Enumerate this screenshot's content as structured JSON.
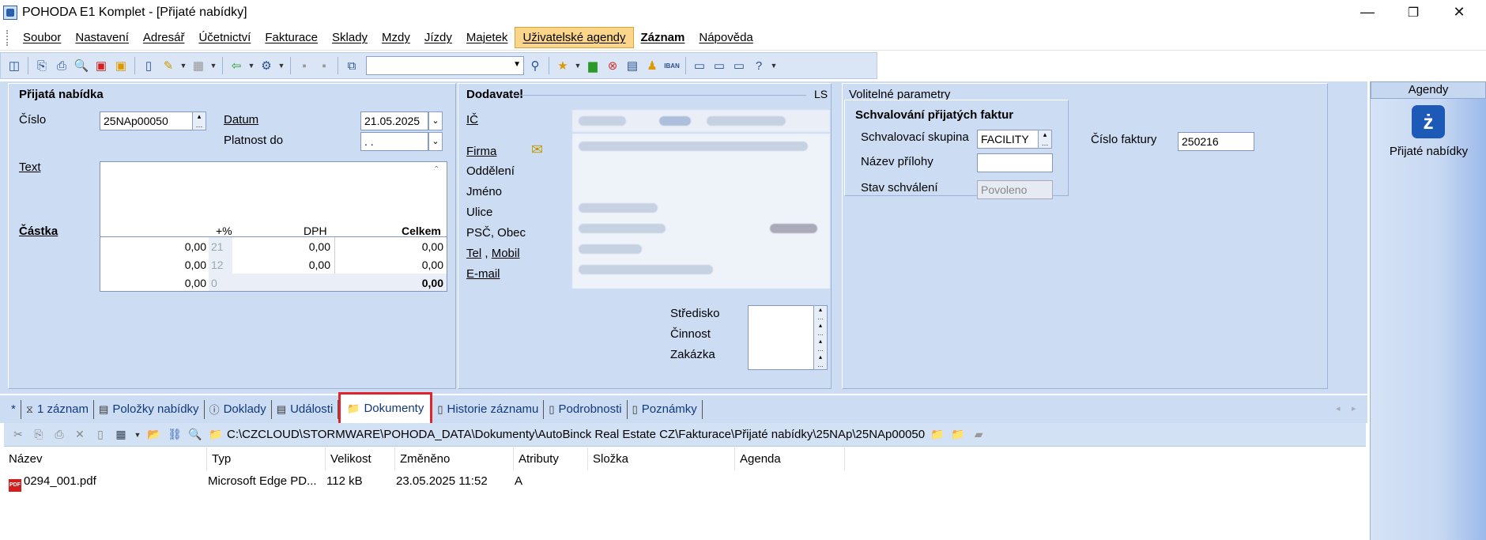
{
  "window": {
    "title": "POHODA E1 Komplet - [Přijaté nabídky]",
    "minimize": "—",
    "restore": "❐",
    "close": "✕"
  },
  "menu": [
    "Soubor",
    "Nastavení",
    "Adresář",
    "Účetnictví",
    "Fakturace",
    "Sklady",
    "Mzdy",
    "Jízdy",
    "Majetek",
    "Uživatelské agendy",
    "Záznam",
    "Nápověda"
  ],
  "toolbar": {
    "combo_value": ""
  },
  "prijata_nabidka": {
    "section": "Přijatá nabídka",
    "cislo_label": "Číslo",
    "cislo": "25NAp00050",
    "datum_label": "Datum",
    "datum": "21.05.2025",
    "platnost_label": "Platnost do",
    "platnost": " . .",
    "text_label": "Text",
    "castka_label": "Částka",
    "col_pct": "+%",
    "col_dph": "DPH",
    "col_celkem": "Celkem",
    "rows": [
      {
        "zaklad": "0,00",
        "pct": "21",
        "dph": "0,00",
        "celkem": "0,00"
      },
      {
        "zaklad": "0,00",
        "pct": "12",
        "dph": "0,00",
        "celkem": "0,00"
      },
      {
        "zaklad": "0,00",
        "pct": "0",
        "dph": "",
        "celkem": "0,00"
      }
    ]
  },
  "dodavatel": {
    "section": "Dodavatel",
    "ls": "LS",
    "ic": "IČ",
    "firma": "Firma",
    "oddeleni": "Oddělení",
    "jmeno": "Jméno",
    "ulice": "Ulice",
    "psc": "PSČ, Obec",
    "tel": "Tel",
    "comma": ",",
    "mobil": "Mobil",
    "email": "E-mail",
    "stredisko": "Středisko",
    "cinnost": "Činnost",
    "zakazka": "Zakázka"
  },
  "volitelne": {
    "section": "Volitelné parametry",
    "group": "Schvalování přijatých faktur",
    "skupina_label": "Schvalovací skupina",
    "skupina": "FACILITY",
    "priloha_label": "Název přílohy",
    "priloha": "",
    "stav_label": "Stav schválení",
    "stav": "Povoleno",
    "faktura_label": "Číslo faktury",
    "faktura": "250216"
  },
  "agendy": {
    "header": "Agendy",
    "item": "Přijaté nabídky"
  },
  "tabs": [
    {
      "label": "*",
      "icon": ""
    },
    {
      "label": "1 záznam",
      "icon": "⧖"
    },
    {
      "label": "Položky nabídky",
      "icon": "▤"
    },
    {
      "label": "Doklady",
      "icon": "ⓘ"
    },
    {
      "label": "Události",
      "icon": "▤"
    },
    {
      "label": "Dokumenty",
      "icon": "📁"
    },
    {
      "label": "Historie záznamu",
      "icon": "▯"
    },
    {
      "label": "Podrobnosti",
      "icon": "▯"
    },
    {
      "label": "Poznámky",
      "icon": "▯"
    }
  ],
  "documents": {
    "path": "C:\\CZCLOUD\\STORMWARE\\POHODA_DATA\\Dokumenty\\AutoBinck Real Estate CZ\\Fakturace\\Přijaté nabídky\\25NAp\\25NAp00050",
    "columns": [
      "Název",
      "Typ",
      "Velikost",
      "Změněno",
      "Atributy",
      "Složka",
      "Agenda"
    ],
    "files": [
      {
        "nazev": "0294_001.pdf",
        "typ": "Microsoft Edge PD...",
        "velikost": "112 kB",
        "zmeneno": "23.05.2025 11:52",
        "atributy": "A",
        "slozka": "",
        "agenda": ""
      }
    ]
  }
}
